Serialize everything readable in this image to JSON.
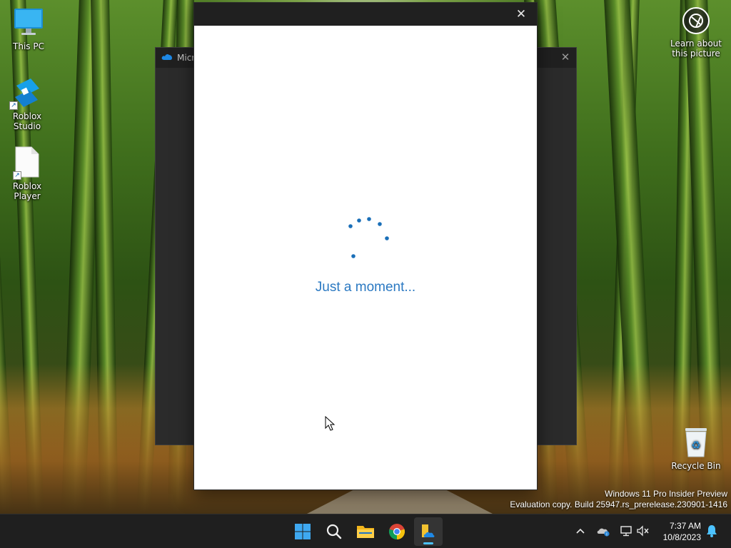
{
  "desktop": {
    "icons": [
      {
        "label": "This PC",
        "icon": "monitor-icon"
      },
      {
        "label": "Roblox Studio",
        "icon": "roblox-studio-icon"
      },
      {
        "label": "Roblox Player",
        "icon": "blank-file-icon"
      },
      {
        "label": "Recycle Bin",
        "icon": "recycle-bin-icon"
      }
    ],
    "learn_label": "Learn about this picture",
    "watermark_line1": "Windows 11 Pro Insider Preview",
    "watermark_line2": "Evaluation copy. Build 25947.rs_prerelease.230901-1416"
  },
  "background_window": {
    "title": "Micr",
    "icon": "onedrive-cloud-icon"
  },
  "dialog": {
    "status_text": "Just a moment...",
    "spinner_color": "#1a6fb8"
  },
  "taskbar": {
    "apps": [
      {
        "name": "Start",
        "icon": "windows-start-icon"
      },
      {
        "name": "Search",
        "icon": "search-icon"
      },
      {
        "name": "File Explorer",
        "icon": "file-explorer-icon"
      },
      {
        "name": "Google Chrome",
        "icon": "chrome-icon"
      },
      {
        "name": "OneDrive setup",
        "icon": "onedrive-setup-icon",
        "active": true
      }
    ],
    "tray": [
      "chevron-up-icon",
      "onedrive-status-icon",
      "network-icon",
      "volume-muted-icon"
    ],
    "time": "7:37 AM",
    "date": "10/8/2023",
    "accent": "#4cc2ff"
  }
}
